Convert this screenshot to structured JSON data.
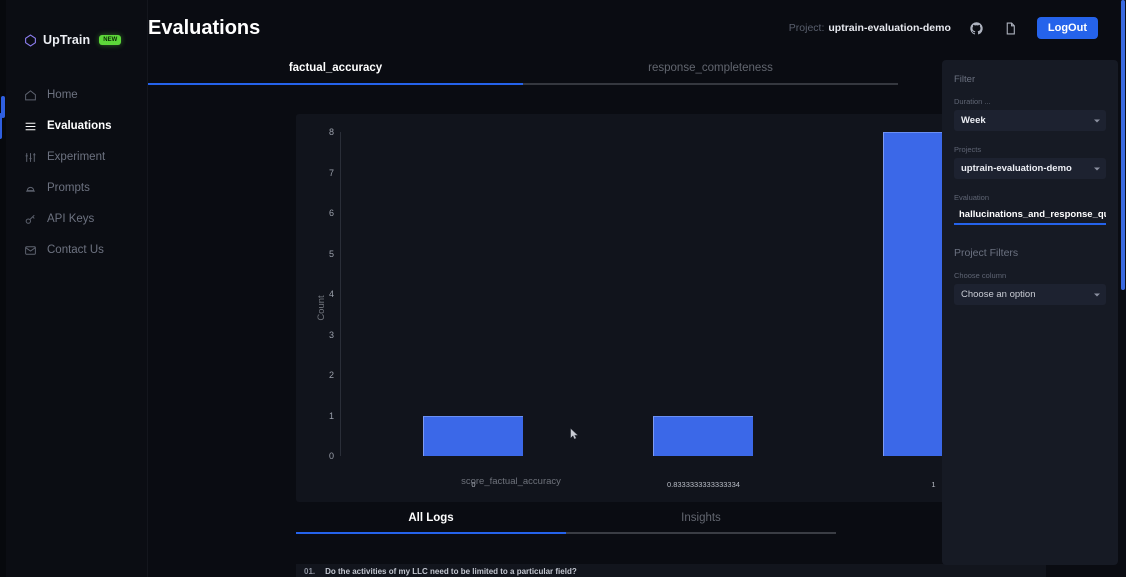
{
  "brand": {
    "name": "UpTrain",
    "badge": "NEW",
    "logo_icon": "uptrain-diamond-logo"
  },
  "sidebar": {
    "items": [
      {
        "label": "Home",
        "icon": "home-icon",
        "active": false
      },
      {
        "label": "Evaluations",
        "icon": "list-lines-icon",
        "active": true
      },
      {
        "label": "Experiment",
        "icon": "sliders-icon",
        "active": false
      },
      {
        "label": "Prompts",
        "icon": "bell-icon",
        "active": false
      },
      {
        "label": "API Keys",
        "icon": "key-icon",
        "active": false
      },
      {
        "label": "Contact Us",
        "icon": "mail-icon",
        "active": false
      }
    ]
  },
  "header": {
    "title": "Evaluations",
    "project_label": "Project:",
    "project_value": "uptrain-evaluation-demo",
    "github_icon": "github-icon",
    "docs_icon": "docs-icon",
    "logout_label": "LogOut"
  },
  "metric_tabs": [
    {
      "label": "factual_accuracy",
      "active": true
    },
    {
      "label": "response_completeness",
      "active": false
    }
  ],
  "logs": {
    "tabs": [
      {
        "label": "All Logs",
        "active": true
      },
      {
        "label": "Insights",
        "active": false
      }
    ],
    "download_icon": "download-icon",
    "first_row": {
      "index": "01.",
      "text": "Do the activities of my LLC need to be limited to a particular field?"
    }
  },
  "filter_panel": {
    "title": "Filter",
    "duration": {
      "label": "Duration ...",
      "value": "Week"
    },
    "project": {
      "label": "Projects",
      "value": "uptrain-evaluation-demo"
    },
    "evaluation": {
      "label": "Evaluation",
      "value": "hallucinations_and_response_quali"
    },
    "project_filters_title": "Project Filters",
    "choose_column": {
      "label": "Choose column",
      "value": "Choose an option"
    }
  },
  "colors": {
    "accent_blue": "#2563eb",
    "bar_blue": "#3b68e8",
    "badge_green": "#5dd83a",
    "panel_bg": "#161a24",
    "chart_bg": "#11141c"
  },
  "chart_data": {
    "type": "bar",
    "title": "",
    "xlabel": "score_factual_accuracy",
    "ylabel": "Count",
    "categories": [
      "0",
      "0.8333333333333334",
      "1"
    ],
    "values": [
      1,
      1,
      8
    ],
    "ylim": [
      0,
      8
    ],
    "yticks": [
      0,
      1,
      2,
      3,
      4,
      5,
      6,
      7,
      8
    ],
    "grid": false,
    "legend": "none",
    "bar_color": "#3b68e8"
  }
}
